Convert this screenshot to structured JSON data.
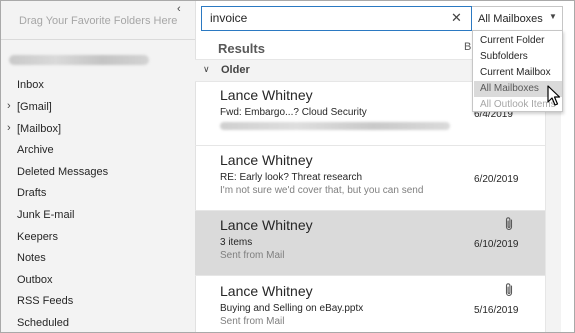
{
  "sidebar": {
    "drop_hint": "Drag Your Favorite Folders Here",
    "account_label": "blurred account email",
    "folders": [
      {
        "label": "Inbox",
        "has_caret": false
      },
      {
        "label": "[Gmail]",
        "has_caret": true
      },
      {
        "label": "[Mailbox]",
        "has_caret": true
      },
      {
        "label": "Archive",
        "has_caret": false
      },
      {
        "label": "Deleted Messages",
        "has_caret": false
      },
      {
        "label": "Drafts",
        "has_caret": false
      },
      {
        "label": "Junk E-mail",
        "has_caret": false
      },
      {
        "label": "Keepers",
        "has_caret": false
      },
      {
        "label": "Notes",
        "has_caret": false
      },
      {
        "label": "Outbox",
        "has_caret": false
      },
      {
        "label": "RSS Feeds",
        "has_caret": false
      },
      {
        "label": "Scheduled",
        "has_caret": false
      }
    ]
  },
  "search": {
    "query": "invoice",
    "scope": "All Mailboxes",
    "scope_options": [
      "Current Folder",
      "Subfolders",
      "Current Mailbox",
      "All Mailboxes",
      "All Outlook Items"
    ],
    "selected_option": "All Mailboxes"
  },
  "results": {
    "title": "Results",
    "sort_partial": "B",
    "group": "Older",
    "messages": [
      {
        "sender": "Lance Whitney",
        "subject": "Fwd: Embargo...? Cloud Security",
        "preview": "",
        "date": "6/4/2019",
        "attachment": false,
        "selected": false
      },
      {
        "sender": "Lance Whitney",
        "subject": "RE: Early look? Threat research",
        "preview": "I'm not sure we'd cover that, but you can send",
        "date": "6/20/2019",
        "attachment": false,
        "selected": false
      },
      {
        "sender": "Lance Whitney",
        "subject": "3 items",
        "preview": "Sent from Mail",
        "date": "6/10/2019",
        "attachment": true,
        "selected": true
      },
      {
        "sender": "Lance Whitney",
        "subject": "Buying and Selling on eBay.pptx",
        "preview": "Sent from Mail",
        "date": "5/16/2019",
        "attachment": true,
        "selected": false
      }
    ]
  },
  "colors": {
    "accent": "#2b79c2",
    "selected_row": "#dadada",
    "sidebar_bg": "#f3f3f3"
  },
  "icons": {
    "collapse": "chevron-left-icon",
    "clear": "close-icon",
    "dropdown": "caret-down-icon",
    "group": "chevron-down-icon",
    "attachment": "paperclip-icon",
    "cursor": "mouse-pointer-icon"
  }
}
